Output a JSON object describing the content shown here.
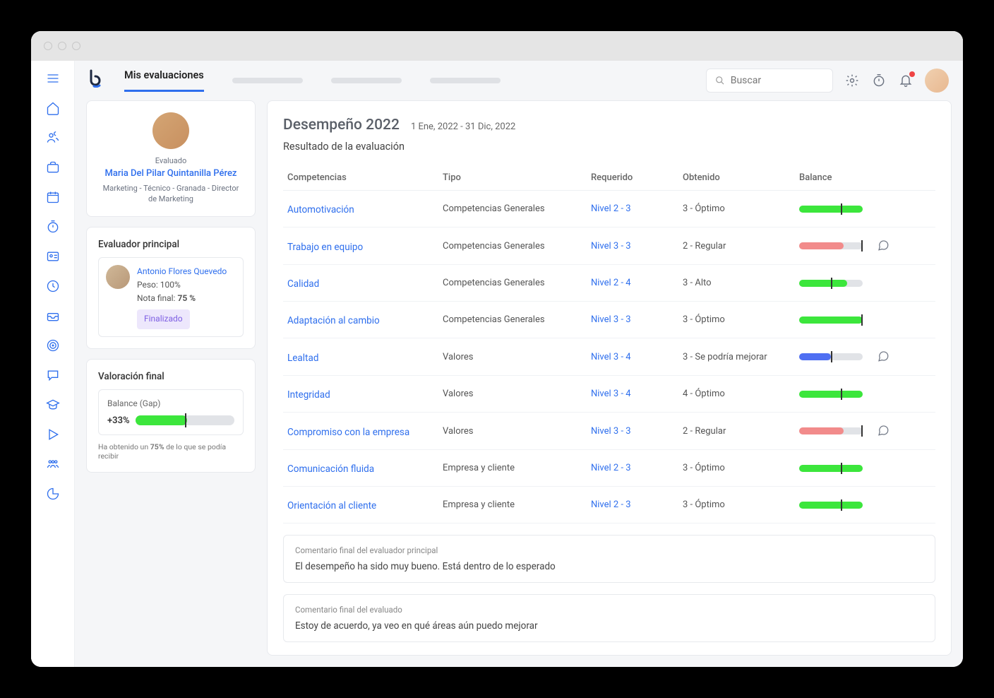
{
  "header": {
    "tab_active": "Mis evaluaciones",
    "search_placeholder": "Buscar"
  },
  "profile": {
    "label": "Evaluado",
    "name": "Maria Del Pilar Quintanilla Pérez",
    "meta": "Marketing - Técnico - Granada - Director de Marketing"
  },
  "evaluator": {
    "section_title": "Evaluador principal",
    "name": "Antonio Flores Quevedo",
    "weight": "Peso: 100%",
    "grade_label": "Nota final: ",
    "grade_value": "75 %",
    "status": "Finalizado"
  },
  "valuation": {
    "section_title": "Valoración final",
    "balance_label": "Balance (Gap)",
    "pct": "+33%",
    "fill": 52,
    "marker": 50,
    "footnote_a": "Ha obtenido un ",
    "footnote_b": "75%",
    "footnote_c": " de lo que se podía recibir"
  },
  "pane": {
    "title": "Desempeño 2022",
    "dates": "1 Ene, 2022 - 31 Dic, 2022",
    "subtitle": "Resultado de la evaluación",
    "cols": {
      "c1": "Competencias",
      "c2": "Tipo",
      "c3": "Requerido",
      "c4": "Obtenido",
      "c5": "Balance"
    }
  },
  "rows": [
    {
      "comp": "Automotivación",
      "tipo": "Competencias Generales",
      "req": "Nivel 2 - 3",
      "obt": "3 - Óptimo",
      "color": "#3ce63c",
      "fill": 100,
      "marker": 65,
      "chat": false
    },
    {
      "comp": "Trabajo en equipo",
      "tipo": "Competencias Generales",
      "req": "Nivel 3 - 3",
      "obt": "2 - Regular",
      "color": "#f28b8b",
      "fill": 70,
      "marker": 98,
      "chat": true
    },
    {
      "comp": "Calidad",
      "tipo": "Competencias Generales",
      "req": "Nivel 2 - 4",
      "obt": "3 - Alto",
      "color": "#3ce63c",
      "fill": 75,
      "marker": 50,
      "chat": false
    },
    {
      "comp": "Adaptación al cambio",
      "tipo": "Competencias Generales",
      "req": "Nivel 3 - 3",
      "obt": "3 - Óptimo",
      "color": "#3ce63c",
      "fill": 100,
      "marker": 98,
      "chat": false
    },
    {
      "comp": "Lealtad",
      "tipo": "Valores",
      "req": "Nivel 3 - 4",
      "obt": "3 - Se podría mejorar",
      "color": "#4f6ff2",
      "fill": 50,
      "marker": 50,
      "chat": true
    },
    {
      "comp": "Integridad",
      "tipo": "Valores",
      "req": "Nivel 3 - 4",
      "obt": "4 - Óptimo",
      "color": "#3ce63c",
      "fill": 100,
      "marker": 65,
      "chat": false
    },
    {
      "comp": "Compromiso con la empresa",
      "tipo": "Valores",
      "req": "Nivel 3 - 3",
      "obt": "2 - Regular",
      "color": "#f28b8b",
      "fill": 70,
      "marker": 98,
      "chat": true
    },
    {
      "comp": "Comunicación fluida",
      "tipo": "Empresa y cliente",
      "req": "Nivel 2 - 3",
      "obt": "3 - Óptimo",
      "color": "#3ce63c",
      "fill": 100,
      "marker": 65,
      "chat": false
    },
    {
      "comp": "Orientación al cliente",
      "tipo": "Empresa y cliente",
      "req": "Nivel 2 - 3",
      "obt": "3 - Óptimo",
      "color": "#3ce63c",
      "fill": 100,
      "marker": 65,
      "chat": false
    }
  ],
  "comments": [
    {
      "label": "Comentario final del evaluador principal",
      "text": "El desempeño ha sido muy bueno. Está dentro de lo esperado"
    },
    {
      "label": "Comentario final del evaluado",
      "text": "Estoy de acuerdo, ya veo en qué áreas aún puedo mejorar"
    }
  ]
}
